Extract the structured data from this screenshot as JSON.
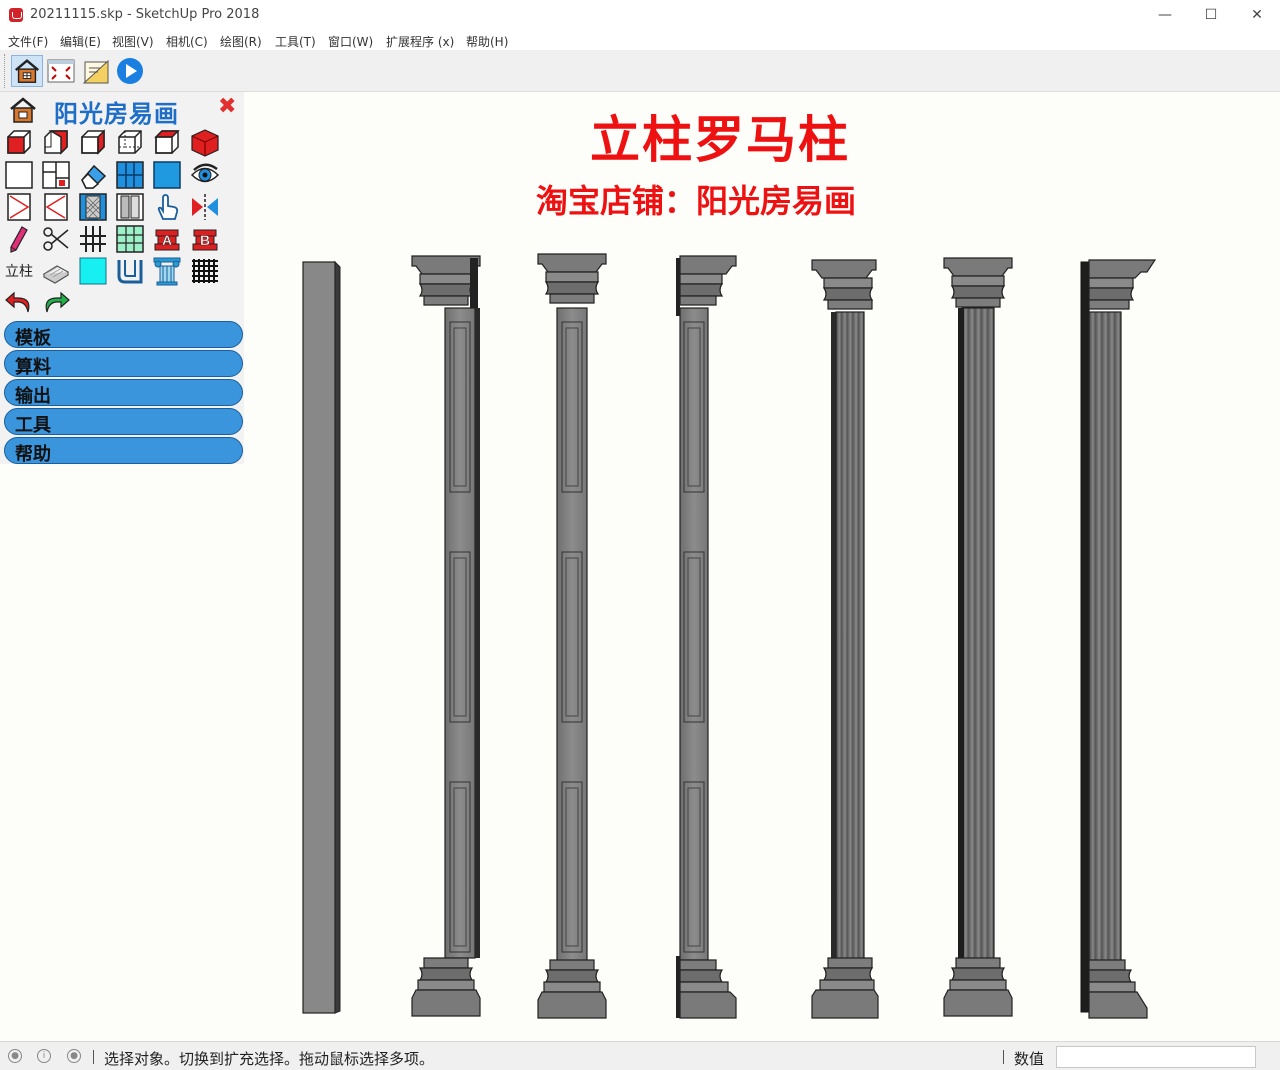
{
  "window": {
    "title": "20211115.skp - SketchUp Pro 2018",
    "minimize": "—",
    "maximize": "☐",
    "close": "✕"
  },
  "menubar": {
    "items": [
      "文件(F)",
      "编辑(E)",
      "视图(V)",
      "相机(C)",
      "绘图(R)",
      "工具(T)",
      "窗口(W)",
      "扩展程序 (x)",
      "帮助(H)"
    ]
  },
  "toolbar": {
    "buttons": [
      "house-icon",
      "zoom-extents-icon",
      "drawing-icon",
      "play-icon"
    ]
  },
  "panel": {
    "title": "阳光房易画",
    "close": "✖",
    "lizhu_label": "立柱",
    "icons": [
      "red-cube-front-icon",
      "cube-side-icon",
      "cube-right-icon",
      "cube-iso-icon",
      "cube-top-icon",
      "solid-red-cube-icon",
      "blank-square-icon",
      "window-grid-icon",
      "eraser-icon",
      "blue-panel-icon",
      "blue-square-icon",
      "eye-icon",
      "door-left-icon",
      "door-right-icon",
      "lattice-door-icon",
      "double-door-icon",
      "hand-pointer-icon",
      "mirror-icon",
      "pencil-icon",
      "scissors-icon",
      "hash-lines-icon",
      "green-grid-icon",
      "profile-a-icon",
      "profile-b-icon",
      "book-icon",
      "cyan-square-icon",
      "gutter-icon",
      "roman-column-icon",
      "mesh-grid-icon",
      "undo-icon",
      "redo-icon"
    ],
    "menu": [
      "模板",
      "算料",
      "输出",
      "工具",
      "帮助"
    ]
  },
  "canvas": {
    "title": "立柱罗马柱",
    "subtitle": "淘宝店铺：阳光房易画"
  },
  "statusbar": {
    "message": "选择对象。切换到扩充选择。拖动鼠标选择多项。",
    "measure_label": "数值",
    "measure_value": ""
  },
  "colors": {
    "accent_blue": "#3b95dd",
    "title_red": "#ee1111",
    "panel_title_blue": "#1e6ec8",
    "column_gray": "#808080"
  }
}
